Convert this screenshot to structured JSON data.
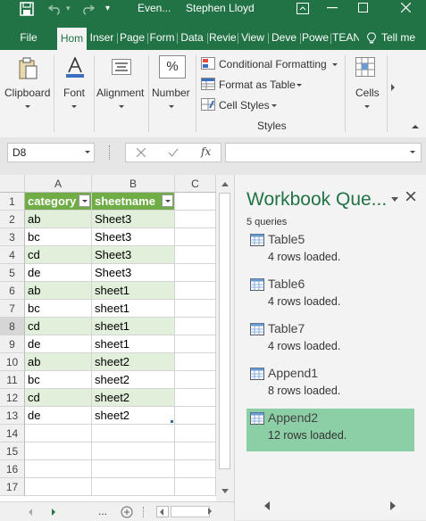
{
  "window": {
    "title_short": "Even...",
    "user": "Stephen Lloyd"
  },
  "tabs": [
    {
      "label": "File"
    },
    {
      "label": "Hom"
    },
    {
      "label": "Inser"
    },
    {
      "label": "Page"
    },
    {
      "label": "Form"
    },
    {
      "label": "Data"
    },
    {
      "label": "Revie"
    },
    {
      "label": "View"
    },
    {
      "label": "Deve"
    },
    {
      "label": "Powe"
    },
    {
      "label": "TEAN"
    },
    {
      "label": "Tell me"
    }
  ],
  "ribbon": {
    "clipboard": "Clipboard",
    "font": "Font",
    "alignment": "Alignment",
    "number": "Number",
    "conditional_formatting": "Conditional Formatting",
    "format_as_table": "Format as Table",
    "cell_styles": "Cell Styles",
    "styles_group": "Styles",
    "cells": "Cells",
    "percent_symbol": "%"
  },
  "formula_bar": {
    "name_box": "D8",
    "fx": "fx",
    "value": ""
  },
  "sheet": {
    "columns": [
      "A",
      "B",
      "C"
    ],
    "header": [
      "category",
      "sheetname"
    ],
    "rows": [
      {
        "num": "1"
      },
      {
        "num": "2",
        "a": "ab",
        "b": "Sheet3"
      },
      {
        "num": "3",
        "a": "bc",
        "b": "Sheet3"
      },
      {
        "num": "4",
        "a": "cd",
        "b": "Sheet3"
      },
      {
        "num": "5",
        "a": "de",
        "b": "Sheet3"
      },
      {
        "num": "6",
        "a": "ab",
        "b": "sheet1"
      },
      {
        "num": "7",
        "a": "bc",
        "b": "sheet1"
      },
      {
        "num": "8",
        "a": "cd",
        "b": "sheet1"
      },
      {
        "num": "9",
        "a": "de",
        "b": "sheet1"
      },
      {
        "num": "10",
        "a": "ab",
        "b": "sheet2"
      },
      {
        "num": "11",
        "a": "bc",
        "b": "sheet2"
      },
      {
        "num": "12",
        "a": "cd",
        "b": "sheet2"
      },
      {
        "num": "13",
        "a": "de",
        "b": "sheet2"
      },
      {
        "num": "14"
      },
      {
        "num": "15"
      },
      {
        "num": "16"
      },
      {
        "num": "17"
      }
    ],
    "sheet_tabs_more": "..."
  },
  "queries_panel": {
    "title": "Workbook Que...",
    "count": "5 queries",
    "items": [
      {
        "name": "Table5",
        "status": "4 rows loaded."
      },
      {
        "name": "Table6",
        "status": "4 rows loaded."
      },
      {
        "name": "Table7",
        "status": "4 rows loaded."
      },
      {
        "name": "Append1",
        "status": "8 rows loaded."
      },
      {
        "name": "Append2",
        "status": "12 rows loaded.",
        "selected": true
      }
    ]
  },
  "colors": {
    "excel_green": "#217346",
    "table_header": "#70ad47",
    "table_band": "#e2efda",
    "selected_query": "#8ccfa6"
  }
}
